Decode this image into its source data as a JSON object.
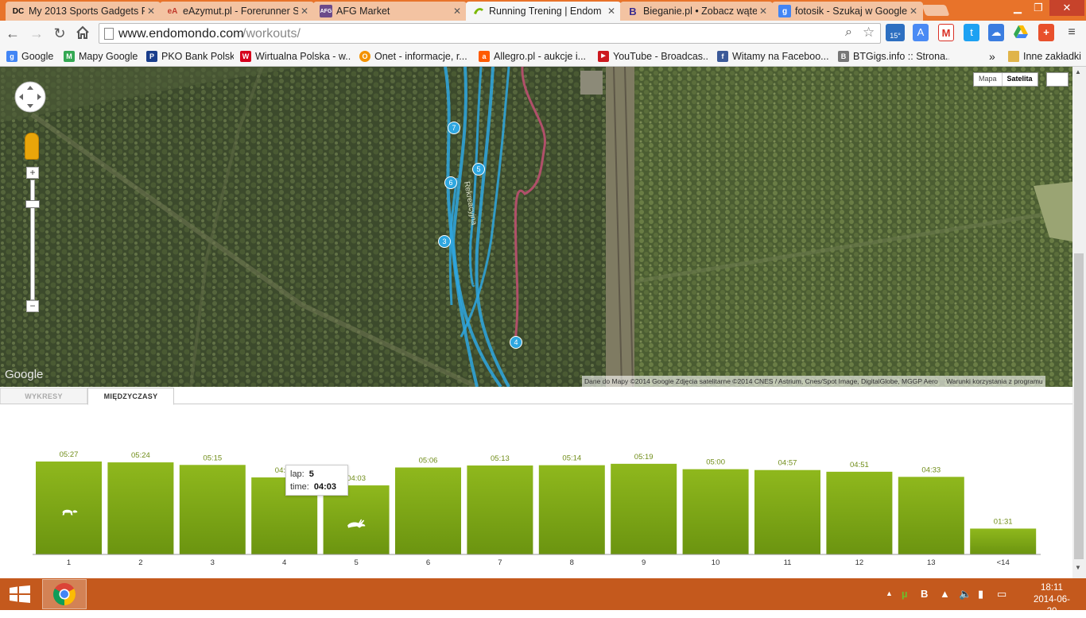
{
  "browser": {
    "tabs": [
      {
        "title": "My 2013 Sports Gadgets R",
        "icon": "dc-rainmaker-favicon",
        "favicon_text": "DC",
        "active": false
      },
      {
        "title": "eAzymut.pl - Forerunner S",
        "icon": "eazymut-favicon",
        "favicon_text": "eA",
        "active": false
      },
      {
        "title": "AFG Market",
        "icon": "afg-favicon",
        "favicon_text": "AFG",
        "active": false
      },
      {
        "title": "Running Trening | Endom",
        "icon": "endomondo-favicon",
        "favicon_text": "",
        "active": true
      },
      {
        "title": "Bieganie.pl • Zobacz wątel",
        "icon": "bieganie-favicon",
        "favicon_text": "B",
        "active": false
      },
      {
        "title": "fotosik - Szukaj w Google",
        "icon": "google-favicon",
        "favicon_text": "g",
        "active": false
      }
    ],
    "url_domain": "www.endomondo.com",
    "url_path": "/workouts/",
    "weather_badge": "15°"
  },
  "bookmarks": [
    {
      "label": "Google",
      "icon": "google-icon",
      "color": "#4285f4",
      "glyph": "g"
    },
    {
      "label": "Mapy Google",
      "icon": "maps-pin-icon",
      "color": "#34a853",
      "glyph": "M"
    },
    {
      "label": "PKO Bank Polski",
      "icon": "pko-icon",
      "color": "#1a3e8c",
      "glyph": "P"
    },
    {
      "label": "Wirtualna Polska - w...",
      "icon": "wp-icon",
      "color": "#d6001c",
      "glyph": "W"
    },
    {
      "label": "Onet - informacje, r...",
      "icon": "onet-icon",
      "color": "#f39200",
      "glyph": "O"
    },
    {
      "label": "Allegro.pl - aukcje i...",
      "icon": "allegro-icon",
      "color": "#ff5a00",
      "glyph": "a"
    },
    {
      "label": "YouTube - Broadcas...",
      "icon": "youtube-icon",
      "color": "#cc181e",
      "glyph": "▶"
    },
    {
      "label": "Witamy na Faceboo...",
      "icon": "facebook-icon",
      "color": "#3b5998",
      "glyph": "f"
    },
    {
      "label": "BTGigs.info :: Strona...",
      "icon": "btgigs-icon",
      "color": "#777777",
      "glyph": "B"
    }
  ],
  "bookmarks_overflow": "»",
  "other_bookmarks": "Inne zakładki",
  "map": {
    "type_buttons": [
      "Mapa",
      "Satelita"
    ],
    "active_type": "Satelita",
    "google_logo": "Google",
    "attribution": "Dane do Mapy ©2014 Google Zdjęcia satelitarne ©2014 CNES / Astrium, Cnes/Spot Image, DigitalGlobe, MGGP Aero",
    "terms": "Warunki korzystania z programu",
    "zoom_in": "+",
    "zoom_out": "−",
    "lap_markers": [
      "7",
      "6",
      "5",
      "3",
      "4"
    ],
    "route_colors": {
      "primary": "#2ea7e0",
      "secondary": "#b0506a"
    }
  },
  "panel": {
    "tabs": [
      "WYKRESY",
      "MIĘDZYCZASY"
    ],
    "active_tab": "MIĘDZYCZASY"
  },
  "chart_data": {
    "type": "bar",
    "categories": [
      "1",
      "2",
      "3",
      "4",
      "5",
      "6",
      "7",
      "8",
      "9",
      "10",
      "11",
      "12",
      "13",
      "<14"
    ],
    "labels": [
      "05:27",
      "05:24",
      "05:15",
      "04:31",
      "04:03",
      "05:06",
      "05:13",
      "05:14",
      "05:19",
      "05:00",
      "04:57",
      "04:51",
      "04:33",
      "01:31"
    ],
    "values_seconds": [
      327,
      324,
      315,
      271,
      243,
      306,
      313,
      314,
      319,
      300,
      297,
      291,
      273,
      91
    ],
    "title": "",
    "xlabel": "",
    "ylabel": "",
    "ylim": [
      0,
      327
    ],
    "slowest_lap_icon": "turtle-icon",
    "fastest_lap_icon": "hare-icon",
    "bar_color": "#7aa414"
  },
  "tooltip": {
    "lap_label": "lap:",
    "lap_value": "5",
    "time_label": "time:",
    "time_value": "04:03"
  },
  "taskbar": {
    "time": "18:11",
    "date": "2014-06-20"
  }
}
